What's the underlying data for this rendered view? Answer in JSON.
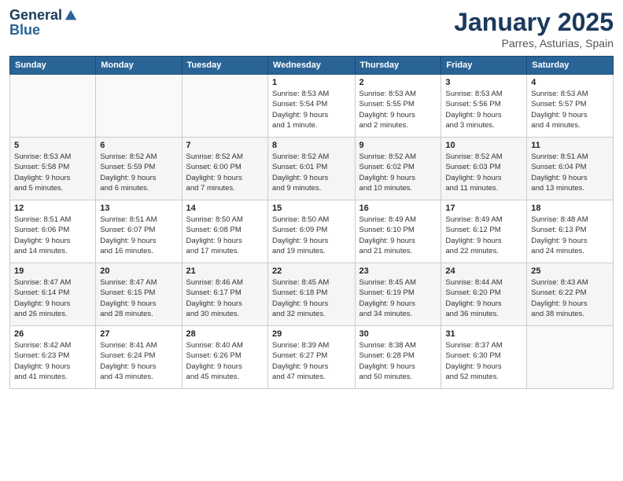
{
  "header": {
    "logo_line1": "General",
    "logo_line2": "Blue",
    "month": "January 2025",
    "location": "Parres, Asturias, Spain"
  },
  "days_of_week": [
    "Sunday",
    "Monday",
    "Tuesday",
    "Wednesday",
    "Thursday",
    "Friday",
    "Saturday"
  ],
  "weeks": [
    [
      {
        "day": "",
        "info": ""
      },
      {
        "day": "",
        "info": ""
      },
      {
        "day": "",
        "info": ""
      },
      {
        "day": "1",
        "info": "Sunrise: 8:53 AM\nSunset: 5:54 PM\nDaylight: 9 hours\nand 1 minute."
      },
      {
        "day": "2",
        "info": "Sunrise: 8:53 AM\nSunset: 5:55 PM\nDaylight: 9 hours\nand 2 minutes."
      },
      {
        "day": "3",
        "info": "Sunrise: 8:53 AM\nSunset: 5:56 PM\nDaylight: 9 hours\nand 3 minutes."
      },
      {
        "day": "4",
        "info": "Sunrise: 8:53 AM\nSunset: 5:57 PM\nDaylight: 9 hours\nand 4 minutes."
      }
    ],
    [
      {
        "day": "5",
        "info": "Sunrise: 8:53 AM\nSunset: 5:58 PM\nDaylight: 9 hours\nand 5 minutes."
      },
      {
        "day": "6",
        "info": "Sunrise: 8:52 AM\nSunset: 5:59 PM\nDaylight: 9 hours\nand 6 minutes."
      },
      {
        "day": "7",
        "info": "Sunrise: 8:52 AM\nSunset: 6:00 PM\nDaylight: 9 hours\nand 7 minutes."
      },
      {
        "day": "8",
        "info": "Sunrise: 8:52 AM\nSunset: 6:01 PM\nDaylight: 9 hours\nand 9 minutes."
      },
      {
        "day": "9",
        "info": "Sunrise: 8:52 AM\nSunset: 6:02 PM\nDaylight: 9 hours\nand 10 minutes."
      },
      {
        "day": "10",
        "info": "Sunrise: 8:52 AM\nSunset: 6:03 PM\nDaylight: 9 hours\nand 11 minutes."
      },
      {
        "day": "11",
        "info": "Sunrise: 8:51 AM\nSunset: 6:04 PM\nDaylight: 9 hours\nand 13 minutes."
      }
    ],
    [
      {
        "day": "12",
        "info": "Sunrise: 8:51 AM\nSunset: 6:06 PM\nDaylight: 9 hours\nand 14 minutes."
      },
      {
        "day": "13",
        "info": "Sunrise: 8:51 AM\nSunset: 6:07 PM\nDaylight: 9 hours\nand 16 minutes."
      },
      {
        "day": "14",
        "info": "Sunrise: 8:50 AM\nSunset: 6:08 PM\nDaylight: 9 hours\nand 17 minutes."
      },
      {
        "day": "15",
        "info": "Sunrise: 8:50 AM\nSunset: 6:09 PM\nDaylight: 9 hours\nand 19 minutes."
      },
      {
        "day": "16",
        "info": "Sunrise: 8:49 AM\nSunset: 6:10 PM\nDaylight: 9 hours\nand 21 minutes."
      },
      {
        "day": "17",
        "info": "Sunrise: 8:49 AM\nSunset: 6:12 PM\nDaylight: 9 hours\nand 22 minutes."
      },
      {
        "day": "18",
        "info": "Sunrise: 8:48 AM\nSunset: 6:13 PM\nDaylight: 9 hours\nand 24 minutes."
      }
    ],
    [
      {
        "day": "19",
        "info": "Sunrise: 8:47 AM\nSunset: 6:14 PM\nDaylight: 9 hours\nand 26 minutes."
      },
      {
        "day": "20",
        "info": "Sunrise: 8:47 AM\nSunset: 6:15 PM\nDaylight: 9 hours\nand 28 minutes."
      },
      {
        "day": "21",
        "info": "Sunrise: 8:46 AM\nSunset: 6:17 PM\nDaylight: 9 hours\nand 30 minutes."
      },
      {
        "day": "22",
        "info": "Sunrise: 8:45 AM\nSunset: 6:18 PM\nDaylight: 9 hours\nand 32 minutes."
      },
      {
        "day": "23",
        "info": "Sunrise: 8:45 AM\nSunset: 6:19 PM\nDaylight: 9 hours\nand 34 minutes."
      },
      {
        "day": "24",
        "info": "Sunrise: 8:44 AM\nSunset: 6:20 PM\nDaylight: 9 hours\nand 36 minutes."
      },
      {
        "day": "25",
        "info": "Sunrise: 8:43 AM\nSunset: 6:22 PM\nDaylight: 9 hours\nand 38 minutes."
      }
    ],
    [
      {
        "day": "26",
        "info": "Sunrise: 8:42 AM\nSunset: 6:23 PM\nDaylight: 9 hours\nand 41 minutes."
      },
      {
        "day": "27",
        "info": "Sunrise: 8:41 AM\nSunset: 6:24 PM\nDaylight: 9 hours\nand 43 minutes."
      },
      {
        "day": "28",
        "info": "Sunrise: 8:40 AM\nSunset: 6:26 PM\nDaylight: 9 hours\nand 45 minutes."
      },
      {
        "day": "29",
        "info": "Sunrise: 8:39 AM\nSunset: 6:27 PM\nDaylight: 9 hours\nand 47 minutes."
      },
      {
        "day": "30",
        "info": "Sunrise: 8:38 AM\nSunset: 6:28 PM\nDaylight: 9 hours\nand 50 minutes."
      },
      {
        "day": "31",
        "info": "Sunrise: 8:37 AM\nSunset: 6:30 PM\nDaylight: 9 hours\nand 52 minutes."
      },
      {
        "day": "",
        "info": ""
      }
    ]
  ]
}
